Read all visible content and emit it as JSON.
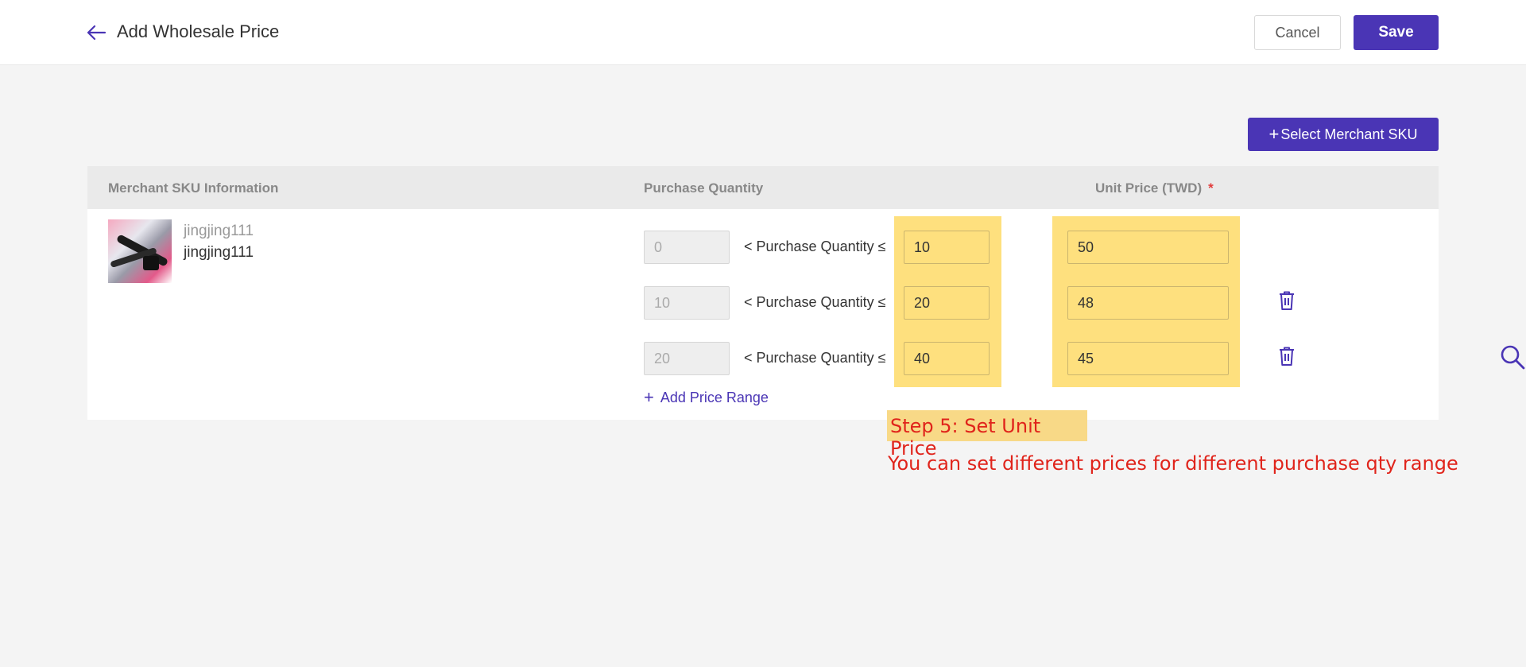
{
  "header": {
    "title": "Add Wholesale Price",
    "cancel_label": "Cancel",
    "save_label": "Save"
  },
  "toolbar": {
    "select_sku_plus": "+",
    "select_sku_label": "Select Merchant SKU"
  },
  "table": {
    "columns": {
      "sku": "Merchant SKU Information",
      "qty": "Purchase Quantity",
      "price": "Unit Price (TWD)",
      "required_mark": "*"
    },
    "sku": {
      "name_top": "jingjing111",
      "name_bottom": "jingjing111"
    },
    "range_label": "< Purchase Quantity ≤",
    "rows": [
      {
        "min": "0",
        "max": "10",
        "price": "50"
      },
      {
        "min": "10",
        "max": "20",
        "price": "48"
      },
      {
        "min": "20",
        "max": "40",
        "price": "45"
      }
    ],
    "add_range_plus": "+",
    "add_range_label": "Add Price Range"
  },
  "annotation": {
    "step_title": "Step 5: Set Unit Price",
    "step_desc": "You can set different prices for different purchase qty range"
  },
  "colors": {
    "accent": "#4a35b5",
    "highlight": "#fee07e",
    "annotation_text": "#e0241b"
  },
  "icons": [
    "arrow-left-icon",
    "trash-icon",
    "plus-icon",
    "search-icon"
  ]
}
